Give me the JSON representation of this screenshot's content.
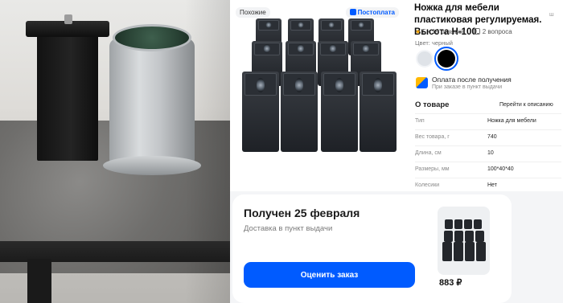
{
  "gallery": {
    "badge_similar": "Похожие",
    "badge_seller": "Постоплата"
  },
  "product": {
    "title": "Ножка для мебели пластиковая регулируемая. Высота Н-100.",
    "title_suffix": "ш",
    "rating": "5",
    "reviews": "19 отзывов",
    "questions": "2 вопроса",
    "color_label": "Цвет: черный",
    "colors": [
      "#dfe3e8",
      "#000000"
    ],
    "selected_color": "черный"
  },
  "payment": {
    "title": "Оплата после получения",
    "subtitle": "При заказе в пункт выдачи"
  },
  "about": {
    "title": "О товаре",
    "link": "Перейти к описанию",
    "specs": [
      {
        "key": "Тип",
        "value": "Ножка для мебели"
      },
      {
        "key": "Вес товара, г",
        "value": "740"
      },
      {
        "key": "Длина, см",
        "value": "10"
      },
      {
        "key": "Размеры, мм",
        "value": "100*40*40"
      },
      {
        "key": "Колесики",
        "value": "Нет"
      }
    ]
  },
  "order": {
    "title": "Получен 25 февраля",
    "subtitle": "Доставка в пункт выдачи",
    "button": "Оценить заказ",
    "price": "883 ₽"
  },
  "colors": {
    "accent": "#005bff",
    "star": "#ffa800"
  }
}
